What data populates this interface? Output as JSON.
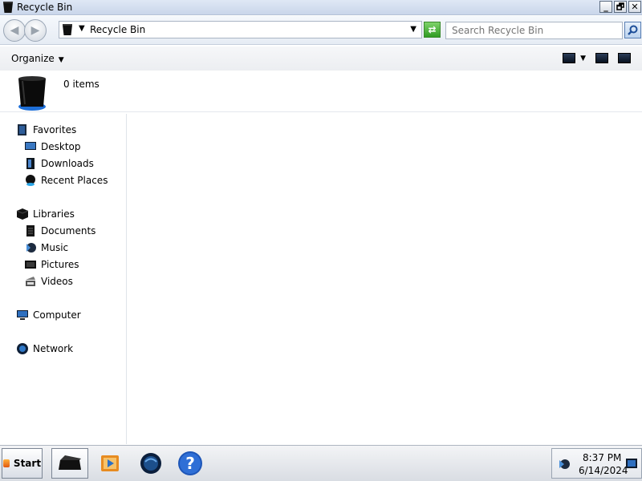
{
  "window": {
    "title": "Recycle Bin",
    "controls": {
      "minimize": "_",
      "maximize": "🗗",
      "close": "✕"
    }
  },
  "address": {
    "location": "Recycle Bin",
    "search_placeholder": "Search Recycle Bin"
  },
  "toolbar": {
    "organize_label": "Organize"
  },
  "details": {
    "item_count": "0 items"
  },
  "nav": {
    "favorites": "Favorites",
    "desktop": "Desktop",
    "downloads": "Downloads",
    "recent_places": "Recent Places",
    "libraries": "Libraries",
    "documents": "Documents",
    "music": "Music",
    "pictures": "Pictures",
    "videos": "Videos",
    "computer": "Computer",
    "network": "Network"
  },
  "taskbar": {
    "start_label": "Start",
    "pinned": [
      "recycle-bin-icon",
      "media-player-icon",
      "globe-icon",
      "help-icon"
    ],
    "time": "8:37 PM",
    "date": "6/14/2024"
  },
  "colors": {
    "accent_blue": "#1e6fd8",
    "refresh_green": "#2f9b22",
    "selection": "#e8edf3"
  }
}
